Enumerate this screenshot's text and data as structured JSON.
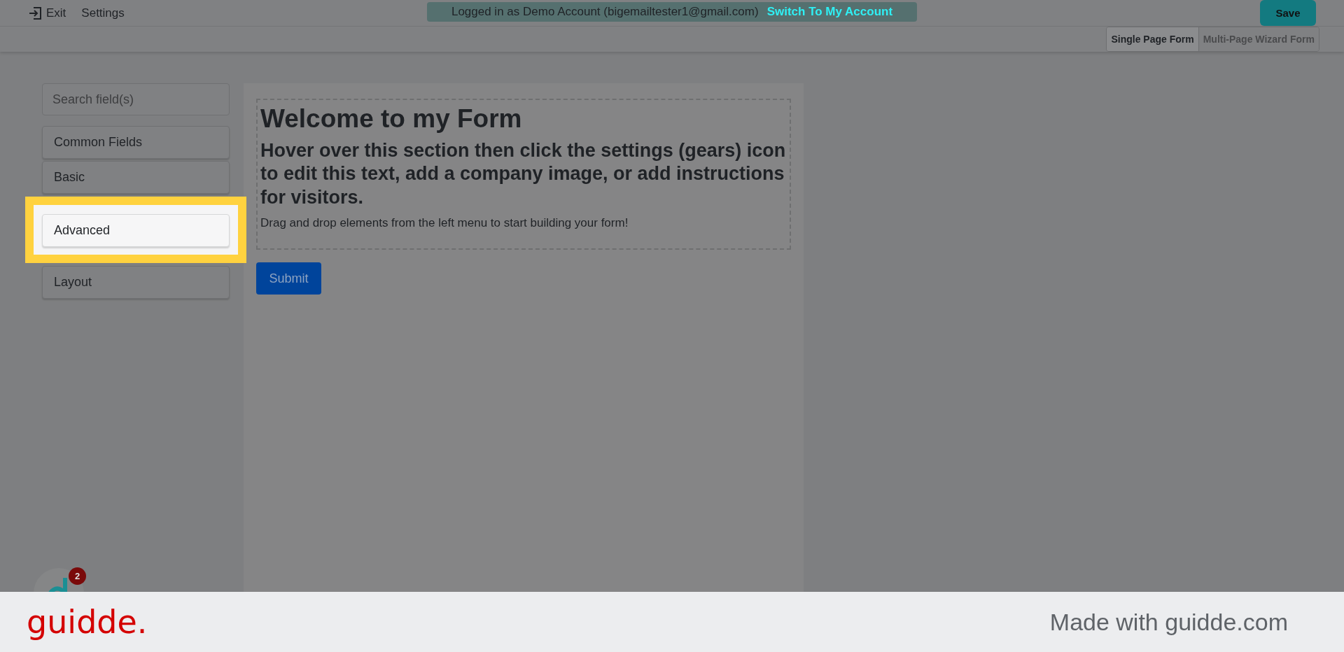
{
  "topbar": {
    "exit": "Exit",
    "settings": "Settings",
    "login_notice": "Logged in as Demo Account (bigemailtester1@gmail.com)",
    "switch_link": "Switch To My Account",
    "save": "Save"
  },
  "view_toggle": [
    {
      "label": "Single Page Form",
      "selected": true
    },
    {
      "label": "Multi-Page Wizard Form",
      "selected": false
    }
  ],
  "sidebar": {
    "search_placeholder": "Search field(s)",
    "items": [
      {
        "label": "Common Fields",
        "highlighted": false
      },
      {
        "label": "Basic",
        "highlighted": false
      },
      {
        "label": "Advanced",
        "highlighted": true
      },
      {
        "label": "Layout",
        "highlighted": false
      }
    ]
  },
  "form": {
    "title": "Welcome to my Form",
    "subtitle": "Hover over this section then click the settings (gears) icon to edit this text, add a company image, or add instructions for visitors.",
    "instructions": "Drag and drop elements from the left menu to start building your form!",
    "submit": "Submit"
  },
  "chat_badge": "2",
  "footer": {
    "brand": "guidde.",
    "credit": "Made with guidde.com"
  }
}
